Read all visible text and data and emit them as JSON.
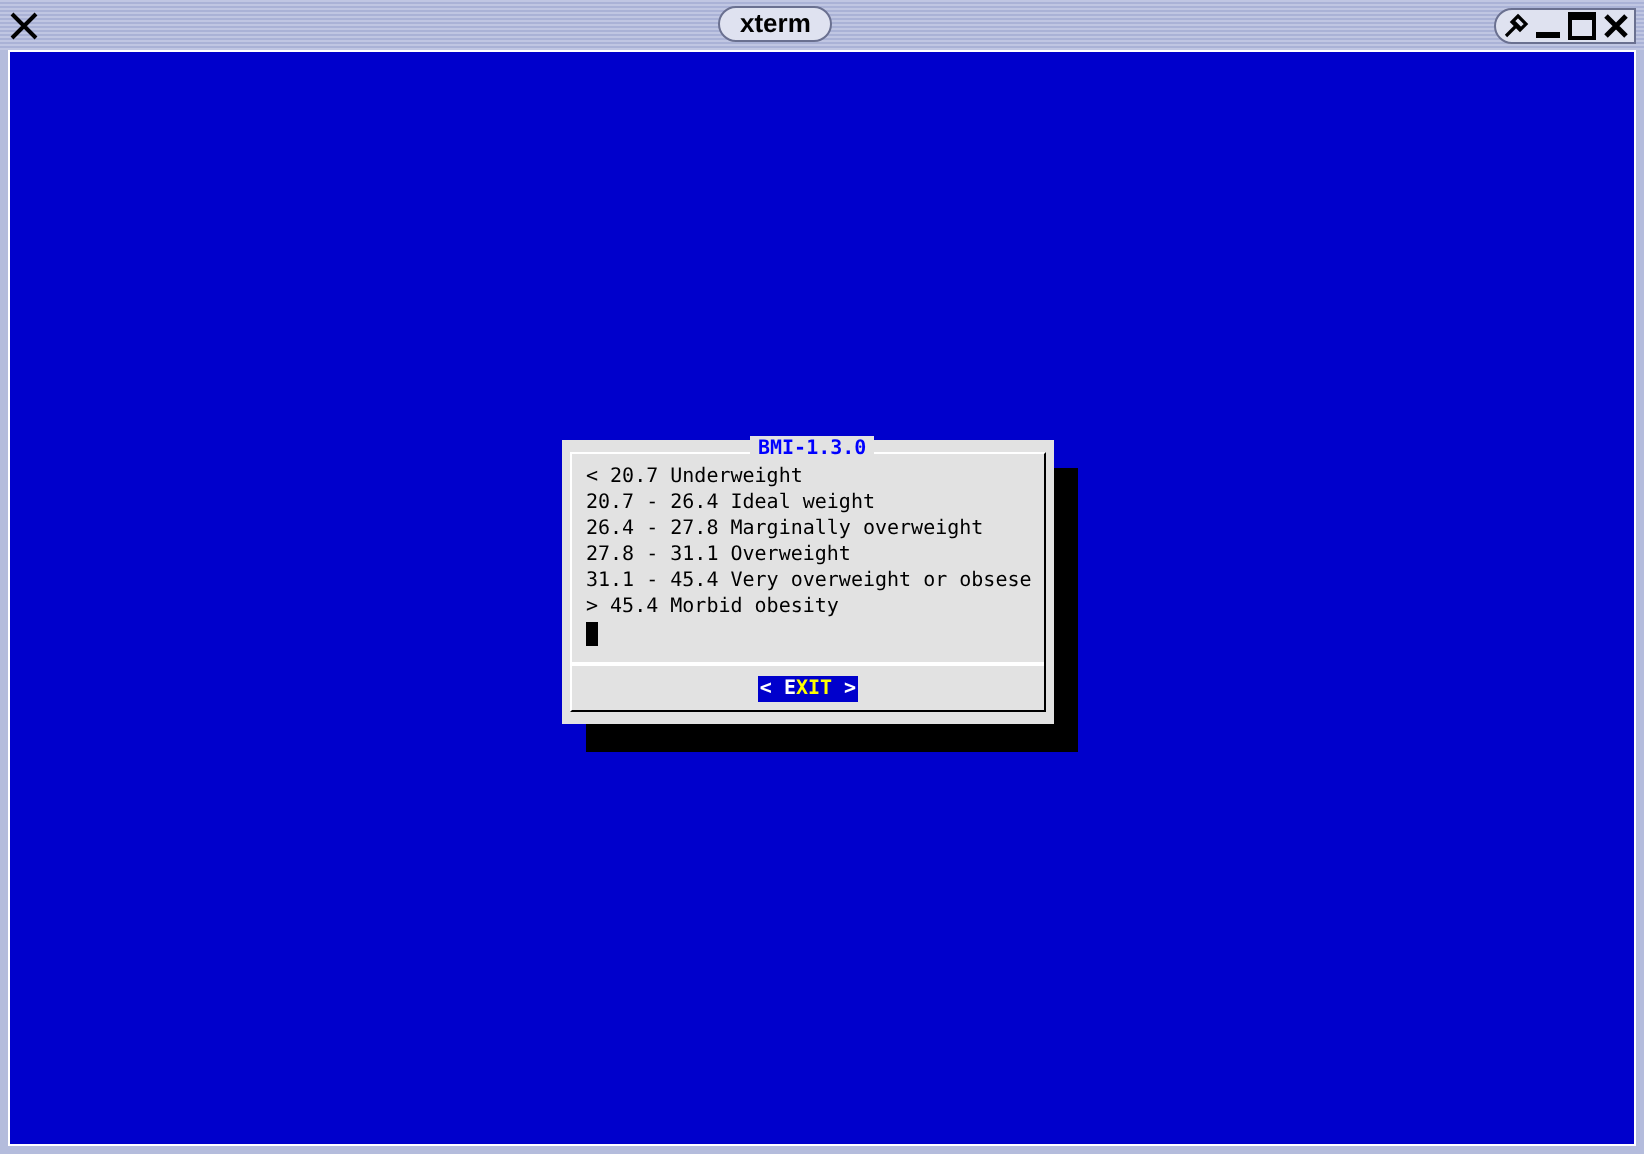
{
  "window": {
    "title": "xterm"
  },
  "dialog": {
    "title": "BMI-1.3.0",
    "lines": [
      "< 20.7 Underweight",
      "20.7 - 26.4 Ideal weight",
      "26.4 - 27.8 Marginally overweight",
      "27.8 - 31.1 Overweight",
      "31.1 - 45.4 Very overweight or obsese",
      "> 45.4 Morbid obesity"
    ],
    "button": {
      "left": "<",
      "hotkey": "E",
      "label_rest": "XIT",
      "right": ">",
      "selected": true
    }
  }
}
